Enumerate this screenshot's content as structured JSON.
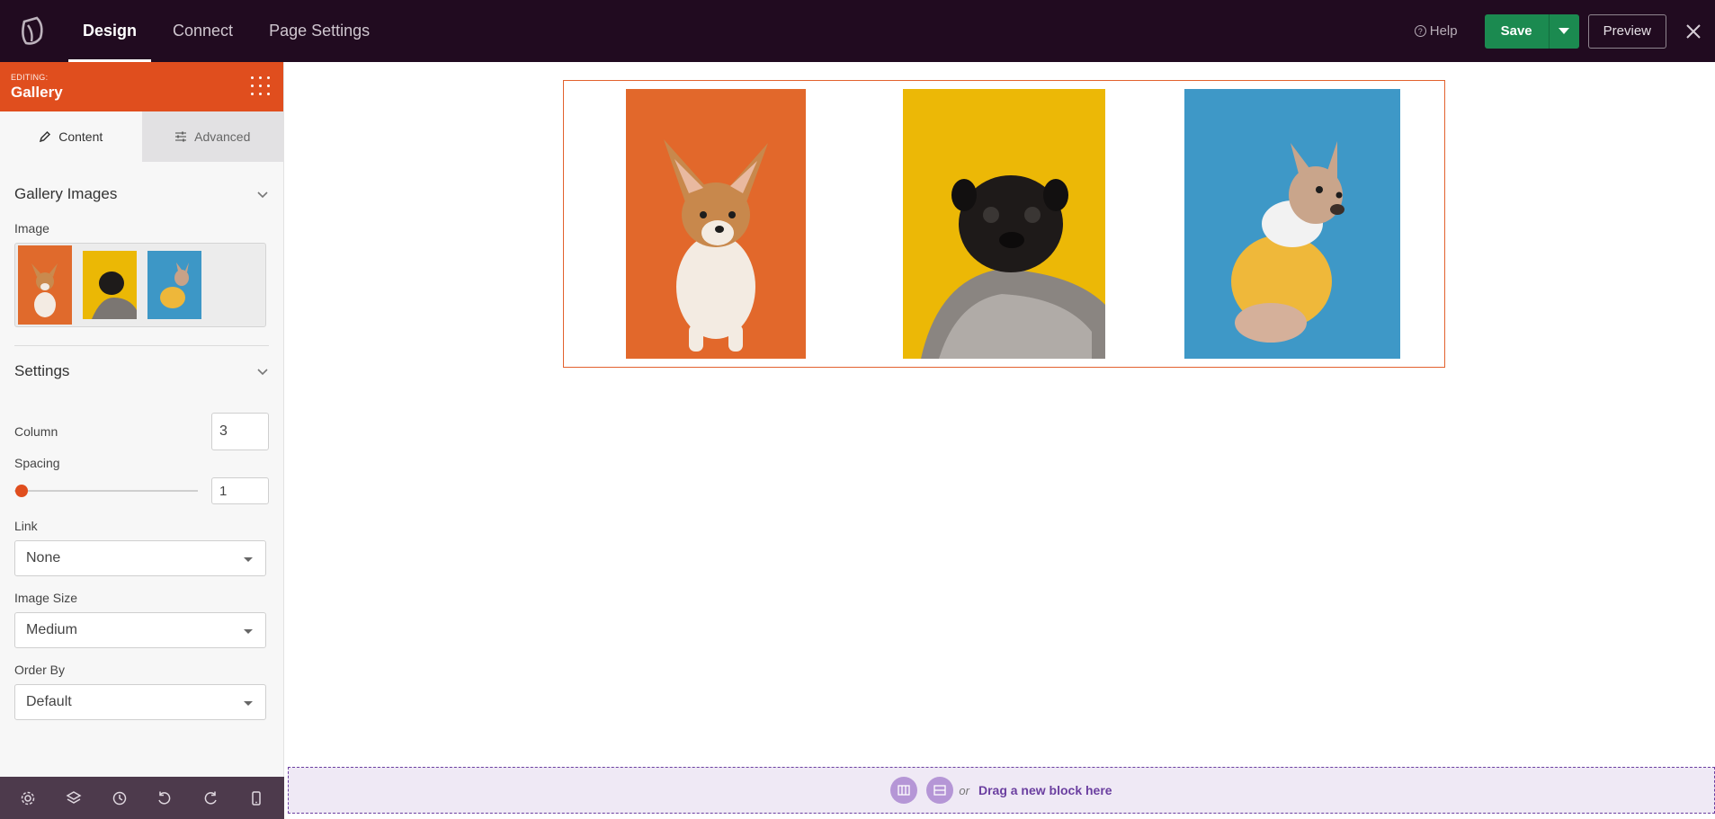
{
  "app": {
    "nav_tabs": [
      {
        "label": "Design",
        "active": true
      },
      {
        "label": "Connect",
        "active": false
      },
      {
        "label": "Page Settings",
        "active": false
      }
    ],
    "help_label": "Help",
    "save_label": "Save",
    "preview_label": "Preview"
  },
  "sidebar": {
    "editing_label": "EDITING:",
    "editing_title": "Gallery",
    "tabs": [
      {
        "label": "Content",
        "icon": "pencil-icon",
        "active": true
      },
      {
        "label": "Advanced",
        "icon": "sliders-icon",
        "active": false
      }
    ],
    "gallery_section": {
      "title": "Gallery Images",
      "image_label": "Image",
      "thumbs": [
        {
          "name": "corgi",
          "bg": "#e06a2c"
        },
        {
          "name": "pug",
          "bg": "#ebb805"
        },
        {
          "name": "frenchie",
          "bg": "#3d97c6"
        }
      ]
    },
    "settings_section": {
      "title": "Settings",
      "column_label": "Column",
      "column_value": "3",
      "spacing_label": "Spacing",
      "spacing_value": "1",
      "link_label": "Link",
      "link_value": "None",
      "image_size_label": "Image Size",
      "image_size_value": "Medium",
      "order_by_label": "Order By",
      "order_by_value": "Default"
    },
    "bottom_icons": [
      "settings-icon",
      "layers-icon",
      "history-icon",
      "undo-icon",
      "redo-icon",
      "mobile-icon"
    ]
  },
  "canvas": {
    "dropzone_or": "or",
    "dropzone_text": "Drag a new block here"
  },
  "colors": {
    "topbar": "#210b20",
    "accent": "#e04e1e",
    "save": "#1b8a50",
    "dropzone": "#6b3fa0"
  }
}
